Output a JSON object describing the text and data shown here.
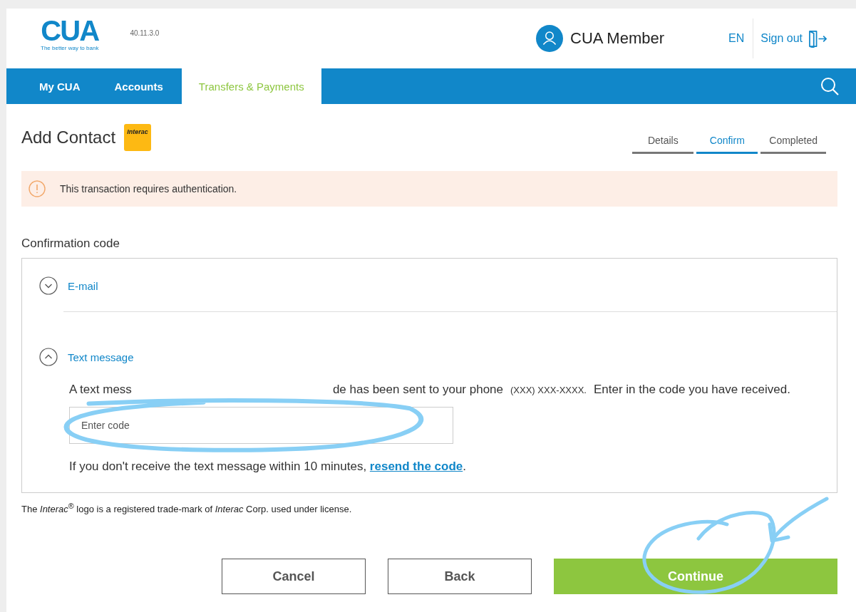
{
  "header": {
    "logo_text": "CUA",
    "logo_tagline": "The better way to bank",
    "version": "40.11.3.0",
    "user": "CUA Member",
    "language": "EN",
    "sign_out": "Sign out"
  },
  "nav": {
    "tabs": [
      {
        "label": "My CUA",
        "selected": false
      },
      {
        "label": "Accounts",
        "selected": false
      },
      {
        "label": "Transfers & Payments",
        "selected": true
      }
    ]
  },
  "page": {
    "title": "Add Contact",
    "logo_text": "Interac",
    "steps": [
      {
        "label": "Details",
        "selected": false
      },
      {
        "label": "Confirm",
        "selected": true
      },
      {
        "label": "Completed",
        "selected": false
      }
    ]
  },
  "alert": {
    "text": "This transaction requires authentication."
  },
  "confirmation": {
    "label": "Confirmation code",
    "methods": [
      {
        "label": "E-mail",
        "expanded": false
      },
      {
        "label": "Text message",
        "expanded": true,
        "message_start": "A text mess",
        "message_rest": "de has been sent to your phone",
        "phone": "(XXX) XXX-XXXX.",
        "message_end": "Enter in the code you have received.",
        "placeholder": "Enter code",
        "resend_text": "If you don't receive the text message within 10 minutes, ",
        "resend_link": "resend the code",
        "resend_end": "."
      }
    ]
  },
  "disclaimer": "The *Interac*$^{®}$ logo is a registered trade-mark of *Interac* Corp. used under license.",
  "buttons": [
    {
      "label": "Cancel",
      "kind": "secondary"
    },
    {
      "label": "Back",
      "kind": "secondary"
    },
    {
      "label": "Continue",
      "kind": "primary"
    }
  ]
}
